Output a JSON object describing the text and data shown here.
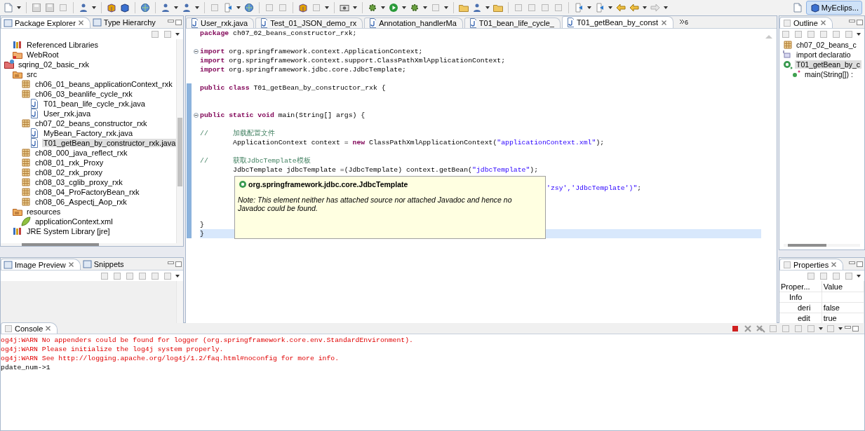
{
  "toolbar": {
    "perspective": "MyEclips..."
  },
  "package_explorer": {
    "tabs": [
      {
        "label": "Package Explorer",
        "selected": true
      },
      {
        "label": "Type Hierarchy",
        "selected": false
      }
    ],
    "tree_tail": [
      {
        "label": "Referenced Libraries",
        "kind": "library",
        "selected": false
      },
      {
        "label": "WebRoot",
        "kind": "folder",
        "selected": false
      }
    ],
    "tree": [
      {
        "label": "sqring_02_basic_rxk",
        "kind": "project",
        "selected": false,
        "children": [
          {
            "label": "src",
            "kind": "source_folder",
            "selected": false,
            "children": [
              {
                "label": "ch06_01_beans_applicationContext_rxk",
                "kind": "package",
                "selected": false
              },
              {
                "label": "ch06_03_beanlife_cycle_rxk",
                "kind": "package",
                "selected": false,
                "children": [
                  {
                    "label": "T01_bean_life_cycle_rxk.java",
                    "kind": "java_file",
                    "selected": false
                  },
                  {
                    "label": "User_rxk.java",
                    "kind": "java_file",
                    "selected": false
                  }
                ]
              },
              {
                "label": "ch07_02_beans_constructor_rxk",
                "kind": "package",
                "selected": false,
                "children": [
                  {
                    "label": "MyBean_Factory_rxk.java",
                    "kind": "java_file",
                    "selected": false
                  },
                  {
                    "label": "T01_getBean_by_constructor_rxk.java",
                    "kind": "java_file",
                    "selected": true
                  }
                ]
              },
              {
                "label": "ch08_000_java_reflect_rxk",
                "kind": "package",
                "selected": false
              },
              {
                "label": "ch08_01_rxk_Proxy",
                "kind": "package",
                "selected": false
              },
              {
                "label": "ch08_02_rxk_proxy",
                "kind": "package",
                "selected": false
              },
              {
                "label": "ch08_03_cglib_proxy_rxk",
                "kind": "package",
                "selected": false
              },
              {
                "label": "ch08_04_ProFactoryBean_rxk",
                "kind": "package",
                "selected": false
              },
              {
                "label": "ch08_06_Aspectj_Aop_rxk",
                "kind": "package",
                "selected": false
              }
            ]
          },
          {
            "label": "resources",
            "kind": "source_folder",
            "selected": false,
            "children": [
              {
                "label": "applicationContext.xml",
                "kind": "xml_file",
                "selected": false
              }
            ]
          },
          {
            "label": "JRE System Library [jre]",
            "kind": "library",
            "selected": false
          }
        ]
      }
    ]
  },
  "image_preview": {
    "tabs": [
      {
        "label": "Image Preview",
        "selected": true
      },
      {
        "label": "Snippets",
        "selected": false
      }
    ]
  },
  "editor": {
    "tabs": [
      {
        "label": "User_rxk.java",
        "selected": false
      },
      {
        "label": "Test_01_JSON_demo_rx",
        "selected": false
      },
      {
        "label": "Annotation_handlerMa",
        "selected": false
      },
      {
        "label": "T01_bean_life_cycle_",
        "selected": false
      },
      {
        "label": "T01_getBean_by_const",
        "selected": true
      }
    ],
    "overflow_count": "6",
    "lines": [
      {
        "fold": false,
        "current": false,
        "tokens": [
          {
            "kind": "keyword",
            "text": "package"
          },
          {
            "kind": "plain",
            "text": " ch07_02_beans_constructor_rxk;"
          }
        ]
      },
      {
        "fold": false,
        "current": false
      },
      {
        "fold": true,
        "current": false,
        "tokens": [
          {
            "kind": "keyword",
            "text": "import"
          },
          {
            "kind": "plain",
            "text": " org.springframework.context.ApplicationContext;"
          }
        ]
      },
      {
        "fold": false,
        "current": false,
        "tokens": [
          {
            "kind": "keyword",
            "text": "import"
          },
          {
            "kind": "plain",
            "text": " org.springframework.context.support.ClassPathXmlApplicationContext;"
          }
        ]
      },
      {
        "fold": false,
        "current": false,
        "tokens": [
          {
            "kind": "keyword",
            "text": "import"
          },
          {
            "kind": "plain",
            "text": " org.springframework.jdbc.core.JdbcTemplate;"
          }
        ]
      },
      {
        "fold": false,
        "current": false
      },
      {
        "fold": false,
        "current": false,
        "tokens": [
          {
            "kind": "keyword",
            "text": "public class"
          },
          {
            "kind": "plain",
            "text": " T01_getBean_by_constructor_rxk {"
          }
        ]
      },
      {
        "fold": false,
        "current": false
      },
      {
        "fold": false,
        "current": false
      },
      {
        "fold": true,
        "current": false,
        "tokens": [
          {
            "kind": "keyword",
            "text": "public static void"
          },
          {
            "kind": "plain",
            "text": " main(String[] args) {"
          }
        ]
      },
      {
        "fold": false,
        "current": false
      },
      {
        "fold": false,
        "current": false,
        "tokens": [
          {
            "kind": "comment",
            "text": "//\t加载配置文件"
          }
        ]
      },
      {
        "fold": false,
        "current": false,
        "tokens": [
          {
            "kind": "plain",
            "text": "\tApplicationContext context = "
          },
          {
            "kind": "keyword",
            "text": "new"
          },
          {
            "kind": "plain",
            "text": " ClassPathXmlApplicationContext("
          },
          {
            "kind": "string",
            "text": "\"applicationContext.xml\""
          },
          {
            "kind": "plain",
            "text": ");"
          }
        ]
      },
      {
        "fold": false,
        "current": false
      },
      {
        "fold": false,
        "current": false,
        "tokens": [
          {
            "kind": "comment",
            "text": "//\t获取JdbcTemplate模板"
          }
        ]
      },
      {
        "fold": false,
        "current": false,
        "tokens": [
          {
            "kind": "plain",
            "text": "\tJdbcTemplate jdbcTemplate =(JdbcTemplate) context.getBean("
          },
          {
            "kind": "string",
            "text": "\"jdbcTemplate\""
          },
          {
            "kind": "plain",
            "text": ");"
          }
        ]
      },
      {
        "fold": false,
        "current": false
      },
      {
        "fold": false,
        "current": false
      },
      {
        "fold": false,
        "current": false
      },
      {
        "fold": false,
        "current": false
      },
      {
        "fold": false,
        "current": false
      },
      {
        "fold": false,
        "current": false,
        "tokens": [
          {
            "kind": "plain",
            "text": "}"
          }
        ]
      },
      {
        "fold": false,
        "current": true,
        "tokens": [
          {
            "kind": "plain",
            "text": "}"
          }
        ]
      }
    ],
    "covered_line_tail": [
      {
        "kind": "string",
        "text": "'zsy','JdbcTemplate')\""
      },
      {
        "kind": "plain",
        "text": ";"
      }
    ],
    "tooltip": {
      "title": "org.springframework.jdbc.core.JdbcTemplate",
      "note": "Note: This element neither has attached source nor attached Javadoc and hence no Javadoc could be found."
    }
  },
  "outline": {
    "tab": "Outline",
    "items": [
      {
        "label": "ch07_02_beans_c",
        "kind": "package",
        "selected": false
      },
      {
        "label": "import declaratio",
        "kind": "imports",
        "selected": false
      },
      {
        "label": "T01_getBean_by_c",
        "kind": "class",
        "selected": true,
        "children": [
          {
            "label": "main(String[]) :",
            "kind": "method",
            "selected": false
          }
        ]
      }
    ]
  },
  "properties": {
    "tab": "Properties",
    "columns": [
      "Proper...",
      "Value"
    ],
    "rows": [
      {
        "kind": "category",
        "property": "Info"
      },
      {
        "kind": "property",
        "property": "deri",
        "value": "false"
      },
      {
        "kind": "property",
        "property": "edit",
        "value": "true"
      }
    ]
  },
  "console": {
    "tab": "Console",
    "lines": [
      {
        "kind": "error",
        "text": "og4j:WARN No appenders could be found for logger (org.springframework.core.env.StandardEnvironment)."
      },
      {
        "kind": "error",
        "text": "og4j:WARN Please initialize the log4j system properly."
      },
      {
        "kind": "error",
        "text": "og4j:WARN See http://logging.apache.org/log4j/1.2/faq.html#noconfig for more info."
      },
      {
        "kind": "output",
        "text": "pdate_num->1"
      }
    ]
  }
}
